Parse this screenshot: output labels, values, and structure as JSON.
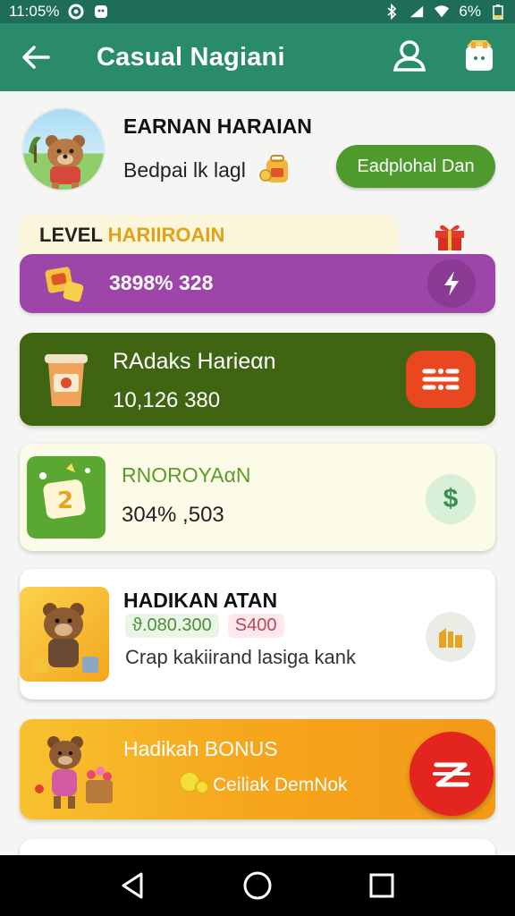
{
  "status_bar": {
    "time": "11:05%",
    "battery": "6%"
  },
  "app_bar": {
    "title": "Casual Nagiani",
    "icons": [
      "back-arrow-icon",
      "profile-icon",
      "shop-icon"
    ]
  },
  "profile": {
    "name": "EARNAN HARAIAN",
    "subtitle": "Bedpai lk lagl",
    "button_label": "Eadplohal Dan"
  },
  "level": {
    "label_prefix": "LEVEL",
    "label_accent": "HARIIROAIN",
    "value": "3898% 328"
  },
  "cards": {
    "rewards": {
      "title": "RAdaks Harieαn",
      "value": "10,126 380"
    },
    "savings": {
      "title": "RNOROYAαN",
      "value": "304% ,503"
    },
    "tasks": {
      "title": "HADIKAN ATAN",
      "chip_green": "ϑ.080.300",
      "chip_pink": "S400",
      "description": "Crap kakiirand lasiga kank"
    },
    "bonus": {
      "title": "Hadikah BONUS",
      "subtitle": "Ceiliak DemNok"
    }
  },
  "colors": {
    "status_bar": "#1e6e57",
    "app_bar": "#2a8a6c",
    "level_bar": "#9d45a8",
    "card_green": "#3f6412",
    "button_green": "#4f9a2d",
    "orange": "#f6a51b",
    "red": "#e4241f"
  }
}
